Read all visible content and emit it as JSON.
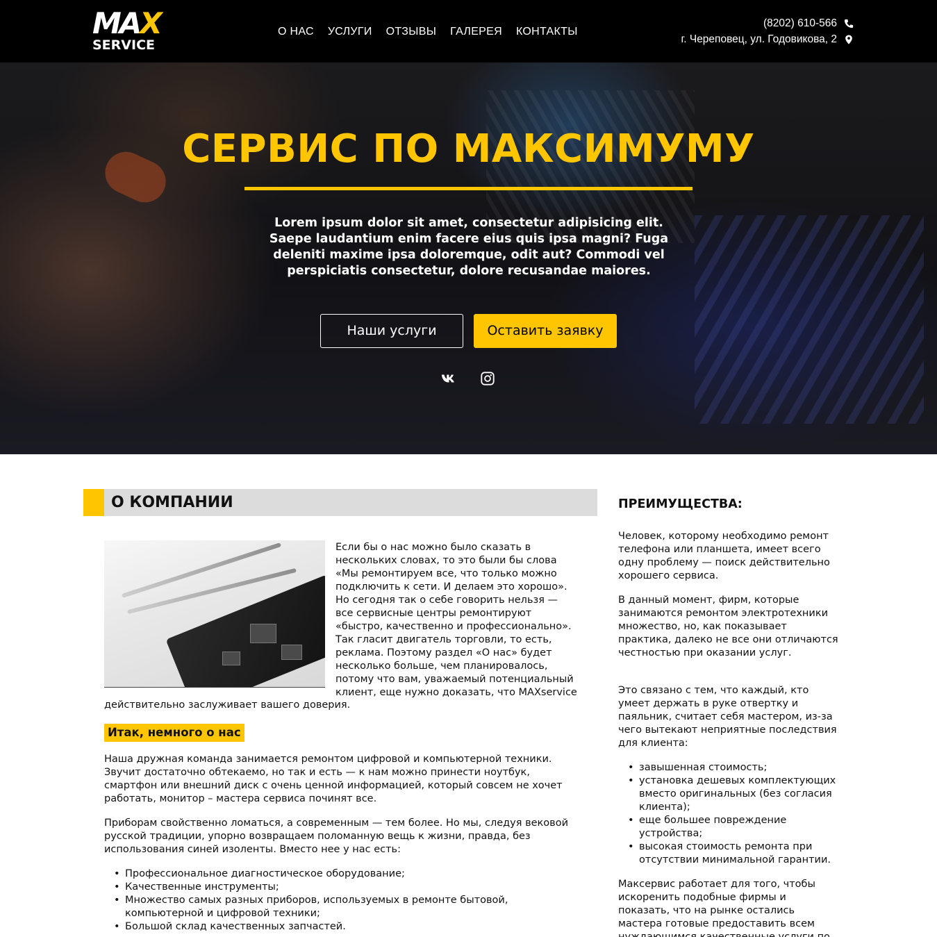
{
  "header": {
    "logo_top": "MA",
    "logo_x": "X",
    "logo_bottom": "SERVICE",
    "nav": [
      "О НАС",
      "УСЛУГИ",
      "ОТЗЫВЫ",
      "ГАЛЕРЕЯ",
      "КОНТАКТЫ"
    ],
    "phone": "(8202) 610-566",
    "address": "г. Череповец, ул. Годовикова, 2",
    "phone_icon": "phone-icon",
    "address_icon": "map-marker-icon"
  },
  "hero": {
    "title": "СЕРВИС ПО МАКСИМУМУ",
    "text": "Lorem ipsum dolor sit amet, consectetur adipisicing elit. Saepe laudantium enim facere eius quis ipsa magni? Fuga deleniti maxime ipsa doloremque, odit aut? Commodi vel perspiciatis consectetur, dolore recusandae maiores.",
    "btn_services": "Наши услуги",
    "btn_request": "Оставить заявку",
    "social": [
      "vk-icon",
      "instagram-icon"
    ]
  },
  "about": {
    "heading": "О КОМПАНИИ",
    "intro_wrap": "Если бы о нас можно было сказать в нескольких словах, то это были бы слова «Мы ремонтируем все, что только можно подключить к сети. И делаем это хорошо». Но сегодня так о себе говорить нельзя — все сервисные центры ремонтируют «быстро, качественно и профессионально». Так гласит двигатель торговли, то есть, реклама. Поэтому раздел «О нас» будет несколько больше, чем планировалось, потому что вам, уважаемый потенциальный клиент, еще нужно доказать, что MAXservice",
    "intro_tail": "действительно заслуживает вашего доверия.",
    "subheading": "Итак, немного о нас",
    "para1": "Наша дружная команда занимается ремонтом цифровой и компьютерной техники. Звучит достаточно обтекаемо, но так и есть — к нам можно принести ноутбук, смартфон или внешний диск с очень ценной информацией, который совсем не хочет работать, монитор – мастера сервиса починят все.",
    "para2": "Приборам свойственно ломаться, а современным — тем более. Но мы, следуя вековой русской традиции, упорно возвращаем поломанную вещь к жизни, правда, без использования синей изоленты. Вместо нее у нас есть:",
    "list": [
      "Профессиональное диагностическое оборудование;",
      "Качественные инструменты;",
      "Множество самых разных приборов, используемых в ремонте бытовой, компьютерной и цифровой техники;",
      "Большой склад качественных запчастей."
    ]
  },
  "sidebar": {
    "title": "ПРЕИМУЩЕСТВА:",
    "p1": "Человек, которому необходимо ремонт телефона или планшета, имеет всего одну проблему — поиск действительно хорошего сервиса.",
    "p2": "В данный момент, фирм, которые занимаются ремонтом электротехники множество, но, как показывает практика, далеко не все они отличаются честностью при оказании услуг.",
    "p3": "Это связано с тем, что каждый, кто умеет держать в руке отвертку и паяльник, считает себя мастером, из-за чего вытекают неприятные последствия для клиента:",
    "list": [
      "завышенная стоимость;",
      "установка дешевых комплектующих вместо оригинальных (без согласия клиента);",
      "еще большее повреждение устройства;",
      "высокая стоимость ремонта при отсутствии минимальной гарантии."
    ],
    "p4": "Максервис работает для того, чтобы искоренить подобные фирмы и показать, что на рынке остались мастера готовые предоставить всем нуждающимся качественные услуги по"
  },
  "colors": {
    "accent": "#ffc600",
    "header_bg": "#000000",
    "heading_bg": "#dcdcdc"
  }
}
